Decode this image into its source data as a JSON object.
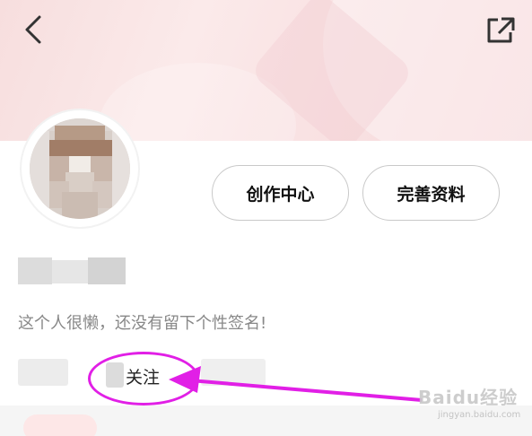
{
  "header": {
    "back_icon": "chevron-left-icon",
    "share_icon": "external-link-icon",
    "background_color": "#f8e1e2"
  },
  "profile": {
    "avatar_icon": "user-avatar",
    "username": "",
    "signature": "这个人很懒，还没有留下个性签名!"
  },
  "actions": {
    "creator_center_label": "创作中心",
    "edit_profile_label": "完善资料"
  },
  "stats": {
    "follow_label": "关注"
  },
  "annotation": {
    "color": "#e11fe6"
  },
  "watermark": {
    "text": "Baidu经验",
    "sub": "jingyan.baidu.com"
  }
}
